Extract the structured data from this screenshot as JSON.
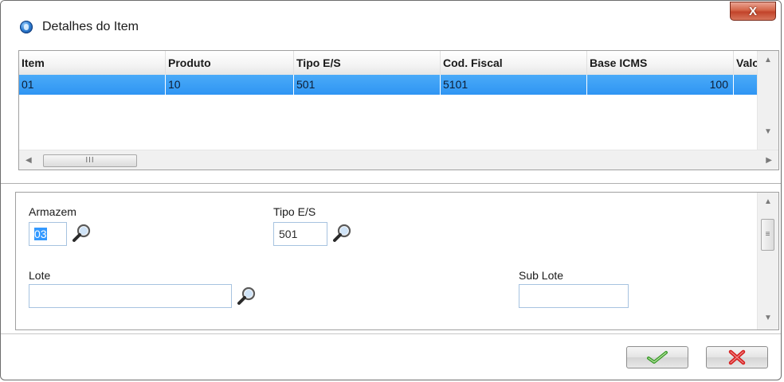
{
  "window": {
    "title": "Detalhes do Item",
    "close_glyph": "X",
    "icons": {
      "app": "app-globe-icon",
      "close": "close-icon"
    }
  },
  "grid": {
    "columns": [
      "Item",
      "Produto",
      "Tipo E/S",
      "Cod. Fiscal",
      "Base ICMS",
      "Valo"
    ],
    "rows": [
      [
        "01",
        "10",
        "501",
        "5101",
        "100",
        ""
      ]
    ],
    "scroll_thumb_glyph": "III",
    "selected_row_color": "#3399ff"
  },
  "form": {
    "armazem": {
      "label": "Armazem",
      "value": "03",
      "icon": "magnifier-icon"
    },
    "tipo_es": {
      "label": "Tipo E/S",
      "value": "501",
      "icon": "magnifier-icon"
    },
    "lote": {
      "label": "Lote",
      "value": "",
      "icon": "magnifier-icon"
    },
    "sub_lote": {
      "label": "Sub Lote",
      "value": ""
    },
    "scroll_thumb_glyph": "≡"
  },
  "buttons": {
    "confirm_icon": "checkmark-icon",
    "cancel_icon": "red-x-icon",
    "confirm_color": "#3a9a2a",
    "cancel_color": "#d62020"
  }
}
